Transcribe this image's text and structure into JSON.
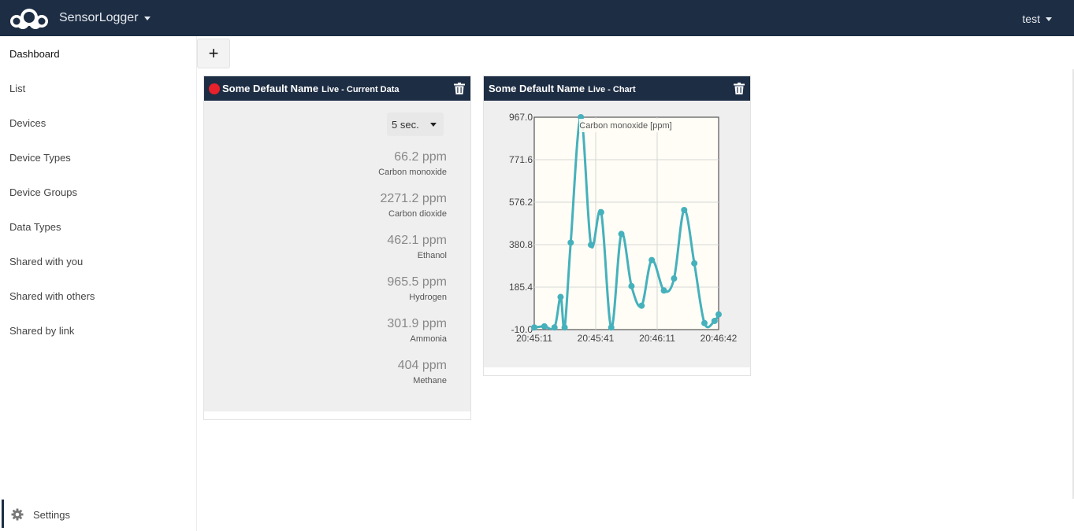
{
  "header": {
    "app_name": "SensorLogger",
    "user": "test",
    "bg_color": "#1d2d44"
  },
  "sidebar": {
    "items": [
      {
        "label": "Dashboard",
        "active": true
      },
      {
        "label": "List"
      },
      {
        "label": "Devices"
      },
      {
        "label": "Device Types"
      },
      {
        "label": "Device Groups"
      },
      {
        "label": "Data Types"
      },
      {
        "label": "Shared with you"
      },
      {
        "label": "Shared with others"
      },
      {
        "label": "Shared by link"
      }
    ],
    "settings_label": "Settings"
  },
  "toolbar": {
    "add_label": "+"
  },
  "widgets": [
    {
      "name": "Some Default Name",
      "subtitle": "Live - Current Data",
      "live_color": "#e8212b",
      "interval": "5 sec.",
      "readings": [
        {
          "value": "66.2 ppm",
          "label": "Carbon monoxide"
        },
        {
          "value": "2271.2 ppm",
          "label": "Carbon dioxide"
        },
        {
          "value": "462.1 ppm",
          "label": "Ethanol"
        },
        {
          "value": "965.5 ppm",
          "label": "Hydrogen"
        },
        {
          "value": "301.9 ppm",
          "label": "Ammonia"
        },
        {
          "value": "404 ppm",
          "label": "Methane"
        }
      ]
    },
    {
      "name": "Some Default Name",
      "subtitle": "Live - Chart"
    }
  ],
  "chart_data": {
    "type": "line",
    "legend": "Carbon monoxide [ppm]",
    "y_ticks": [
      "967.0",
      "771.6",
      "576.2",
      "380.8",
      "185.4",
      "-10.0"
    ],
    "x_ticks": [
      "20:45:11",
      "20:45:41",
      "20:46:11",
      "20:46:42"
    ],
    "ylim": [
      -10.0,
      967.0
    ],
    "xlim_seconds": [
      0,
      91
    ],
    "series_color": "#45b1bc",
    "grid": true,
    "legend_position": "top",
    "series": [
      {
        "name": "Carbon monoxide [ppm]",
        "x": [
          0,
          5,
          10,
          13,
          15,
          18,
          23,
          28,
          33,
          38,
          43,
          48,
          53,
          58,
          64,
          69,
          74,
          79,
          84,
          89,
          91
        ],
        "values": [
          0,
          5,
          0,
          140,
          0,
          390,
          967,
          380,
          530,
          0,
          430,
          190,
          100,
          310,
          170,
          225,
          540,
          295,
          20,
          30,
          60
        ]
      }
    ]
  }
}
